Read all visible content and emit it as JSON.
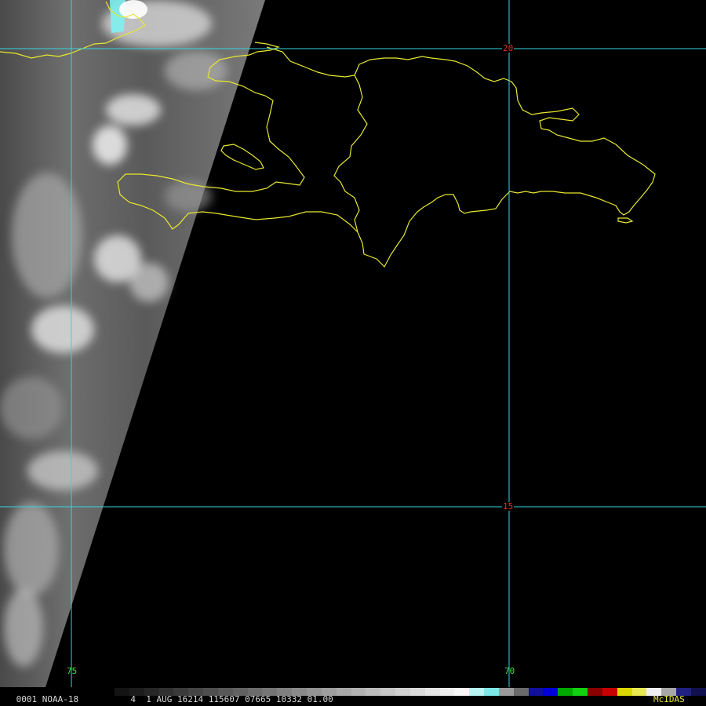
{
  "image": {
    "satellite": "NOAA-18",
    "frame_number": "0001",
    "band": "4",
    "date": "1 AUG 16214",
    "time": "115607",
    "center_lat_code": "07665",
    "center_lon_code": "10332",
    "resolution": "01.00",
    "software": "McIDAS"
  },
  "grid": {
    "color": "#33d6e0",
    "label_color_lat": "#e03020",
    "label_color_lon": "#40e040",
    "latitudes": [
      {
        "label": "20",
        "value": 20
      },
      {
        "label": "15",
        "value": 15
      }
    ],
    "longitudes": [
      {
        "label": "75",
        "value": -75
      },
      {
        "label": "70",
        "value": -70
      }
    ]
  },
  "coastline": {
    "color": "#e8e830",
    "regions": [
      "cuba-east-tip",
      "hispaniola",
      "gonave-island",
      "saona-island"
    ]
  },
  "colors": {
    "status_text": "#d8d8d8",
    "frame_label": "#e8e830",
    "brand_label": "#e8e830",
    "swath_bright": "#f4f4f4",
    "swath_dark": "#3a3a3a",
    "cold_cloud_top": "#7ef0f0"
  },
  "color_scale": [
    "#141414",
    "#1c1c1c",
    "#262626",
    "#303030",
    "#3a3a3a",
    "#444444",
    "#4e4e4e",
    "#585858",
    "#626262",
    "#6c6c6c",
    "#767676",
    "#808080",
    "#8a8a8a",
    "#949494",
    "#9e9e9e",
    "#a8a8a8",
    "#b2b2b2",
    "#bcbcbc",
    "#c6c6c6",
    "#d0d0d0",
    "#dadada",
    "#e4e4e4",
    "#eeeeee",
    "#f8f8f8",
    "#b8f4f4",
    "#7ee8e8",
    "#9a9a9a",
    "#6a6a6a",
    "#10109a",
    "#0000d8",
    "#00a800",
    "#10d010",
    "#8a0000",
    "#c80000",
    "#d8d800",
    "#e8e850",
    "#f0f0f0",
    "#a8a8a8",
    "#202080",
    "#101050"
  ]
}
